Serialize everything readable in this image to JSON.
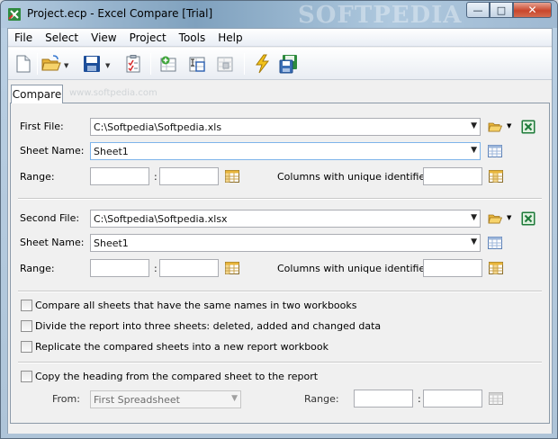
{
  "window": {
    "title": "Project.ecp - Excel Compare [Trial]",
    "watermark": "SOFTPEDIA",
    "minimize_glyph": "—",
    "maximize_glyph": "□",
    "close_glyph": "✕"
  },
  "menu": [
    "File",
    "Select",
    "View",
    "Project",
    "Tools",
    "Help"
  ],
  "tab": {
    "label": "Compare",
    "watermark": "www.softpedia.com"
  },
  "first": {
    "file_label": "First File:",
    "file_value": "C:\\Softpedia\\Softpedia.xls",
    "sheet_label": "Sheet Name:",
    "sheet_value": "Sheet1",
    "range_label": "Range:",
    "range_sep": ":",
    "unique_label": "Columns with unique identifier:"
  },
  "second": {
    "file_label": "Second File:",
    "file_value": "C:\\Softpedia\\Softpedia.xlsx",
    "sheet_label": "Sheet Name:",
    "sheet_value": "Sheet1",
    "range_label": "Range:",
    "range_sep": ":",
    "unique_label": "Columns with unique identifier:"
  },
  "options": [
    "Compare all sheets that have the same names in two workbooks",
    "Divide the report into three sheets: deleted, added and changed data",
    "Replicate the compared sheets into a new report workbook"
  ],
  "heading": {
    "label": "Copy the heading from the compared sheet to the report",
    "from_label": "From:",
    "from_value": "First Spreadsheet",
    "range_label": "Range:",
    "range_sep": ":"
  },
  "colors": {
    "excel_green": "#1e7b3a",
    "folder_yellow": "#e8b53a",
    "lightning": "#f2c21b"
  },
  "icons": {
    "new": "new-file-icon",
    "open": "open-folder-icon",
    "save": "save-disk-icon",
    "check": "checklist-icon",
    "add": "add-sheet-icon",
    "select": "select-range-icon",
    "clear": "clear-icon",
    "compare": "lightning-icon",
    "report": "save-report-icon"
  }
}
